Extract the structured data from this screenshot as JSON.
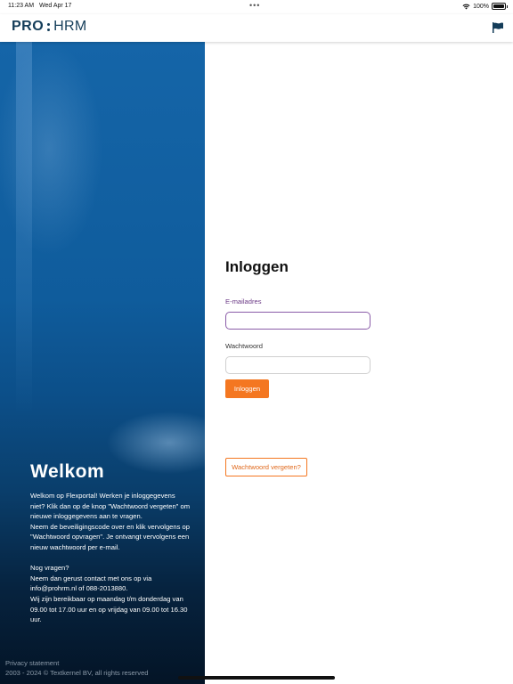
{
  "statusbar": {
    "time": "11:23 AM",
    "date": "Wed Apr 17",
    "battery": "100%"
  },
  "header": {
    "logo_left": "PRO",
    "logo_right": "HRM",
    "flag_icon": "flag-icon",
    "brand_color": "#143d59"
  },
  "welcome": {
    "title": "Welkom",
    "paragraph1": "Welkom op Flexportal! Werken je inloggegevens niet? Klik dan op de knop \"Wachtwoord vergeten\" om nieuwe inloggegevens aan te vragen.",
    "paragraph2": "Neem de beveiligingscode over en klik vervolgens op \"Wachtwoord opvragen\". Je ontvangt vervolgens een nieuw wachtwoord per e-mail.",
    "paragraph3": "Nog vragen?",
    "paragraph4": "Neem dan gerust contact met ons op via info@prohrm.nl of 088-2013880.",
    "paragraph5": "Wij zijn bereikbaar op maandag t/m donderdag van 09.00 tot 17.00 uur en op vrijdag van 09.00 tot 16.30 uur."
  },
  "footer": {
    "privacy": "Privacy statement",
    "copyright": "2003 - 2024 © Textkernel BV, all rights reserved"
  },
  "login": {
    "title": "Inloggen",
    "email_label": "E-mailadres",
    "email_value": "",
    "password_label": "Wachtwoord",
    "password_value": "",
    "login_button": "Inloggen",
    "forgot_button": "Wachtwoord vergeten?",
    "accent_color": "#f47721"
  }
}
